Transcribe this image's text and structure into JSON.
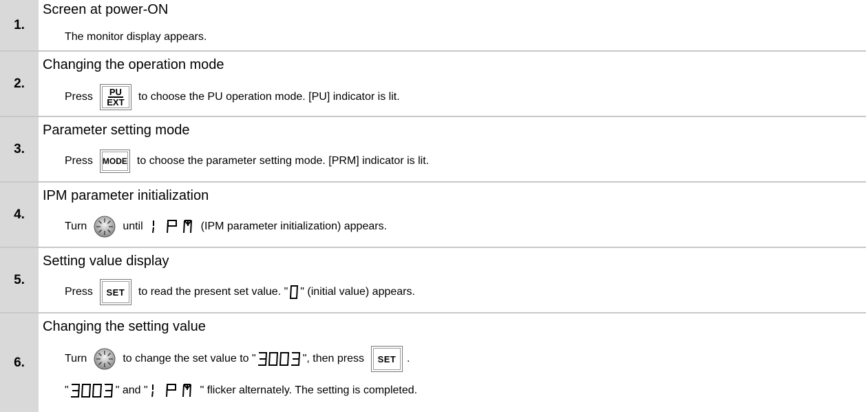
{
  "steps": [
    {
      "num": "1.",
      "title": "Screen at power-ON",
      "text": "The monitor display appears."
    },
    {
      "num": "2.",
      "title": "Changing the operation mode",
      "press": "Press",
      "text": "to choose the PU operation mode. [PU] indicator is lit."
    },
    {
      "num": "3.",
      "title": "Parameter setting mode",
      "press": "Press",
      "text": "to choose the parameter setting mode. [PRM] indicator is lit."
    },
    {
      "num": "4.",
      "title": "IPM parameter initialization",
      "turn": "Turn",
      "until": "until",
      "text": "(IPM parameter initialization) appears."
    },
    {
      "num": "5.",
      "title": "Setting value display",
      "press": "Press",
      "text_a": "to read the present set value. \"",
      "text_b": "\" (initial value) appears."
    },
    {
      "num": "6.",
      "title": "Changing the setting value",
      "turn": "Turn",
      "text_a": "to change the set value to \"",
      "text_b": "\", then press",
      "text_c": ".",
      "line2_a": "\"",
      "line2_b": "\" and \"",
      "line2_c": "\" flicker alternately. The setting is completed."
    }
  ],
  "keys": {
    "pu": "PU",
    "ext": "EXT",
    "mode": "MODE",
    "set": "SET"
  },
  "displays": {
    "ipm": "IPM",
    "zero": "0",
    "value": "3003"
  },
  "icons": {
    "dial": "setting-dial-icon"
  }
}
